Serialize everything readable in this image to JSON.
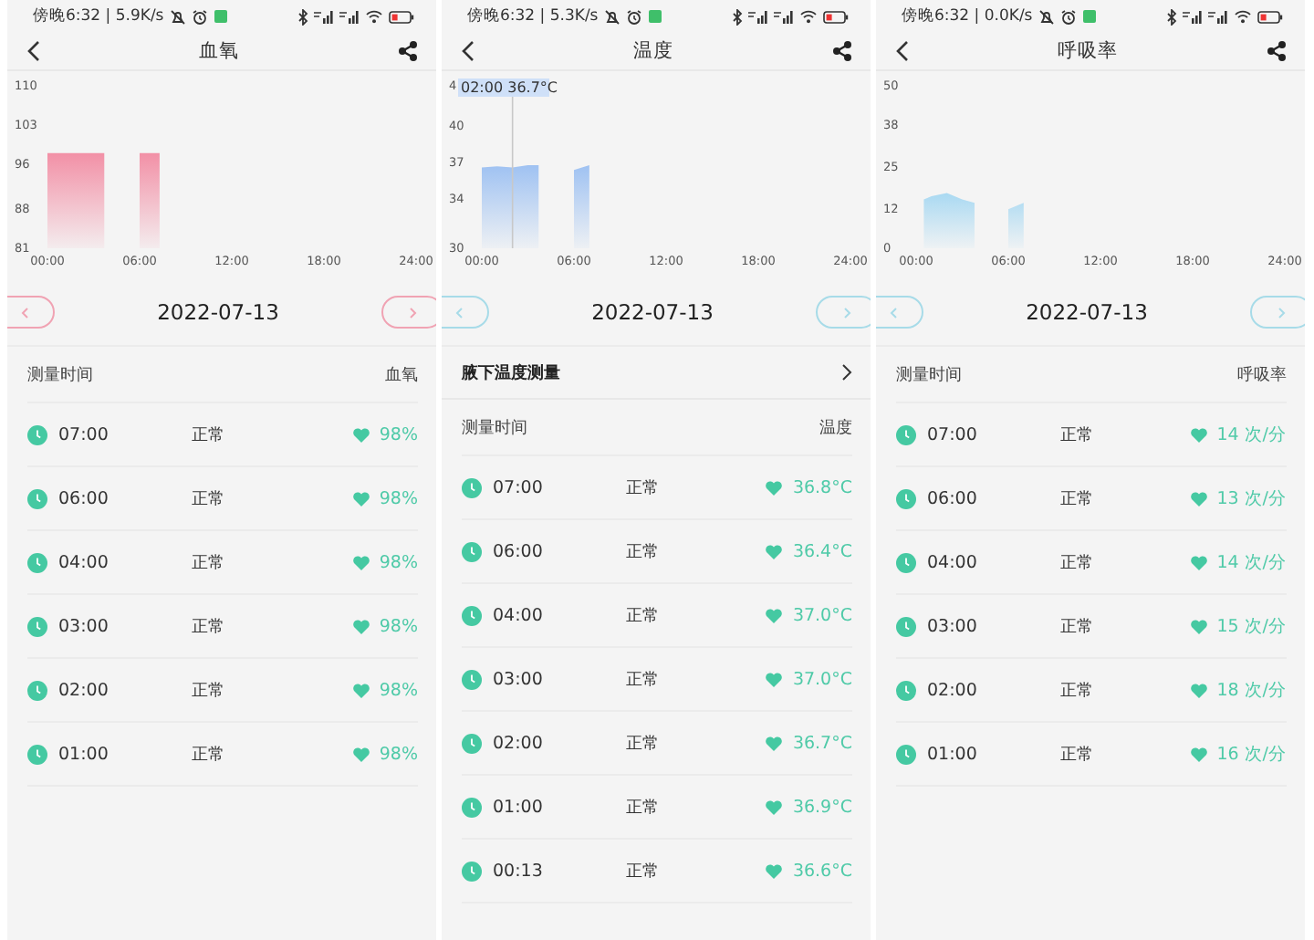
{
  "screens": [
    {
      "color": "#f0a3b3",
      "status_bar": {
        "text": "傍晚6:32 | 5.9K/s"
      },
      "title": "血氧",
      "chart_data": {
        "type": "area",
        "x": [
          0,
          3.7,
          null,
          6,
          7.3
        ],
        "series": [
          {
            "color": "#f290a6",
            "values": [
              98,
              98,
              null,
              98,
              98
            ]
          }
        ],
        "xlim": [
          0,
          24
        ],
        "ylim": [
          81,
          110
        ],
        "xticks": [
          {
            "value": 0,
            "label": "00:00"
          },
          {
            "value": 6,
            "label": "06:00"
          },
          {
            "value": 12,
            "label": "12:00"
          },
          {
            "value": 18,
            "label": "18:00"
          },
          {
            "value": 24,
            "label": "24:00"
          }
        ],
        "yticks": [
          81,
          88,
          96,
          103,
          110
        ]
      },
      "date": "2022-07-13",
      "list_header": [
        "测量时间",
        "血氧"
      ],
      "rows": [
        {
          "time": "07:00",
          "status": "正常",
          "value": "98%"
        },
        {
          "time": "06:00",
          "status": "正常",
          "value": "98%"
        },
        {
          "time": "04:00",
          "status": "正常",
          "value": "98%"
        },
        {
          "time": "03:00",
          "status": "正常",
          "value": "98%"
        },
        {
          "time": "02:00",
          "status": "正常",
          "value": "98%"
        },
        {
          "time": "01:00",
          "status": "正常",
          "value": "98%"
        }
      ]
    },
    {
      "color": "#a7dbe8",
      "status_bar": {
        "text": "傍晚6:32 | 5.3K/s"
      },
      "title": "温度",
      "chart_data": {
        "type": "area",
        "x": [
          0,
          1,
          2,
          3,
          3.7,
          null,
          6,
          7
        ],
        "series": [
          {
            "color": "#9fc2f2",
            "values": [
              36.6,
              36.7,
              36.6,
              36.8,
              36.8,
              null,
              36.4,
              36.8
            ]
          }
        ],
        "xlim": [
          0,
          24
        ],
        "ylim": [
          30,
          40
        ],
        "xticks": [
          {
            "value": 0,
            "label": "00:00"
          },
          {
            "value": 6,
            "label": "06:00"
          },
          {
            "value": 12,
            "label": "12:00"
          },
          {
            "value": 18,
            "label": "18:00"
          },
          {
            "value": 24,
            "label": "24:00"
          }
        ],
        "yticks": [
          30,
          34,
          37,
          40
        ],
        "annotations": [
          "02:00 36.7°C"
        ],
        "ref_lines": [
          {
            "axis": "x",
            "value": 2
          }
        ]
      },
      "chart_tick_fragment": "4",
      "date": "2022-07-13",
      "section_link": "腋下温度测量",
      "list_header": [
        "测量时间",
        "温度"
      ],
      "rows": [
        {
          "time": "07:00",
          "status": "正常",
          "value": "36.8°C"
        },
        {
          "time": "06:00",
          "status": "正常",
          "value": "36.4°C"
        },
        {
          "time": "04:00",
          "status": "正常",
          "value": "37.0°C"
        },
        {
          "time": "03:00",
          "status": "正常",
          "value": "37.0°C"
        },
        {
          "time": "02:00",
          "status": "正常",
          "value": "36.7°C"
        },
        {
          "time": "01:00",
          "status": "正常",
          "value": "36.9°C"
        },
        {
          "time": "00:13",
          "status": "正常",
          "value": "36.6°C"
        }
      ]
    },
    {
      "color": "#a7dbe8",
      "status_bar": {
        "text": "傍晚6:32 | 0.0K/s"
      },
      "title": "呼吸率",
      "chart_data": {
        "type": "area",
        "x": [
          0.5,
          1,
          2,
          3,
          3.8,
          null,
          6,
          7
        ],
        "series": [
          {
            "color": "#a9d9f2",
            "values": [
              15,
              16,
              17,
              15,
              14,
              null,
              12,
              14
            ]
          }
        ],
        "xlim": [
          0,
          24
        ],
        "ylim": [
          0,
          50
        ],
        "xticks": [
          {
            "value": 0,
            "label": "00:00"
          },
          {
            "value": 6,
            "label": "06:00"
          },
          {
            "value": 12,
            "label": "12:00"
          },
          {
            "value": 18,
            "label": "18:00"
          },
          {
            "value": 24,
            "label": "24:00"
          }
        ],
        "yticks": [
          0,
          12,
          25,
          38,
          50
        ]
      },
      "date": "2022-07-13",
      "list_header": [
        "测量时间",
        "呼吸率"
      ],
      "rows": [
        {
          "time": "07:00",
          "status": "正常",
          "value": "14 次/分"
        },
        {
          "time": "06:00",
          "status": "正常",
          "value": "13 次/分"
        },
        {
          "time": "04:00",
          "status": "正常",
          "value": "14 次/分"
        },
        {
          "time": "03:00",
          "status": "正常",
          "value": "15 次/分"
        },
        {
          "time": "02:00",
          "status": "正常",
          "value": "18 次/分"
        },
        {
          "time": "01:00",
          "status": "正常",
          "value": "16 次/分"
        }
      ]
    }
  ]
}
